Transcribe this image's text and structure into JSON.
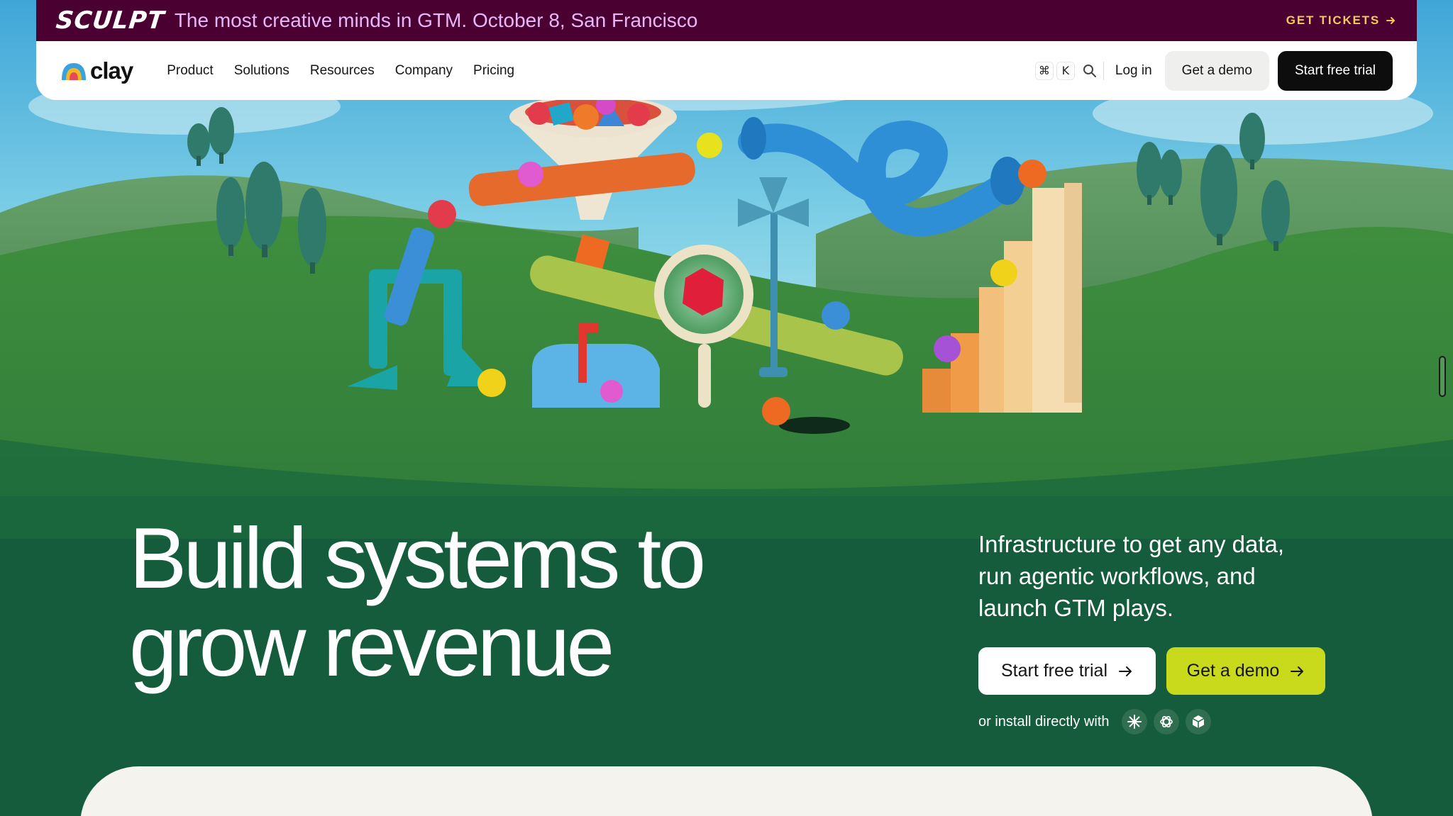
{
  "banner": {
    "logo_text": "SCULPT",
    "text": "The most creative minds in GTM. October 8, San Francisco",
    "cta_label": "GET TICKETS",
    "bg_color": "#4a0131",
    "text_color": "#e7b7f7",
    "cta_color": "#f6c85a"
  },
  "nav": {
    "brand": "clay",
    "links": [
      "Product",
      "Solutions",
      "Resources",
      "Company",
      "Pricing"
    ],
    "shortcut_keys": [
      "⌘",
      "K"
    ],
    "login_label": "Log in",
    "demo_label": "Get a demo",
    "trial_label": "Start free trial"
  },
  "hero": {
    "headline_line1": "Build systems to",
    "headline_line2": "grow revenue",
    "subtext": "Infrastructure to get any data, run agentic workflows, and launch GTM plays.",
    "primary_cta": "Start free trial",
    "secondary_cta": "Get a demo",
    "install_text": "or install directly with",
    "integrations": [
      "claude-icon",
      "openai-icon",
      "cube-icon"
    ],
    "bg_color": "#155c3c",
    "accent_color": "#c9da1d"
  }
}
